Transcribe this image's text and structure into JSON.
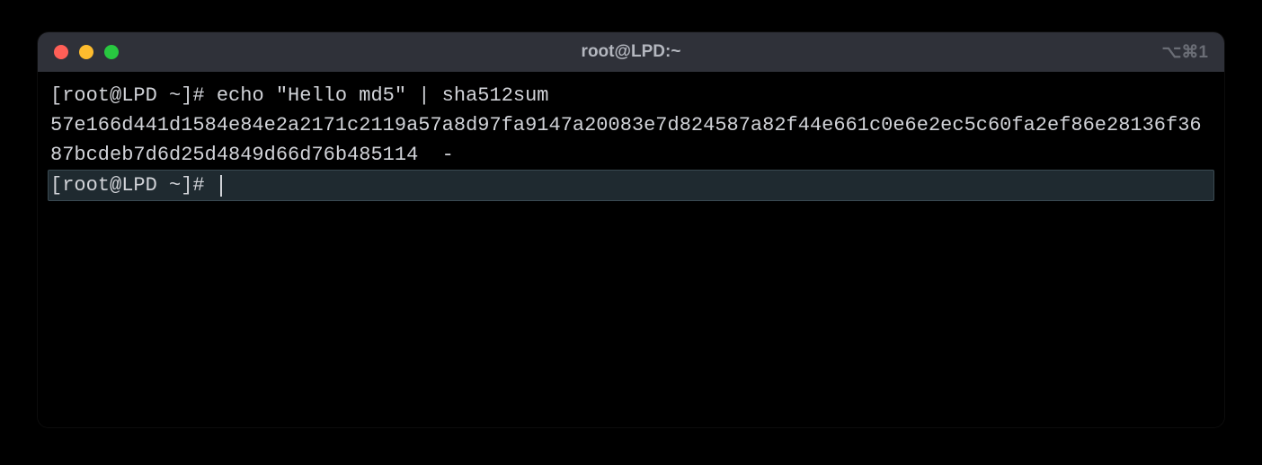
{
  "titlebar": {
    "title": "root@LPD:~",
    "right_indicator": "⌥⌘1"
  },
  "terminal": {
    "lines": [
      {
        "prompt": "[root@LPD ~]# ",
        "command": "echo \"Hello md5\" | sha512sum"
      },
      {
        "output": "57e166d441d1584e84e2a2171c2119a57a8d97fa9147a20083e7d824587a82f44e661c0e6e2ec5c60fa2ef86e28136f3687bcdeb7d6d25d4849d66d76b485114  -"
      }
    ],
    "active_prompt": "[root@LPD ~]# "
  }
}
